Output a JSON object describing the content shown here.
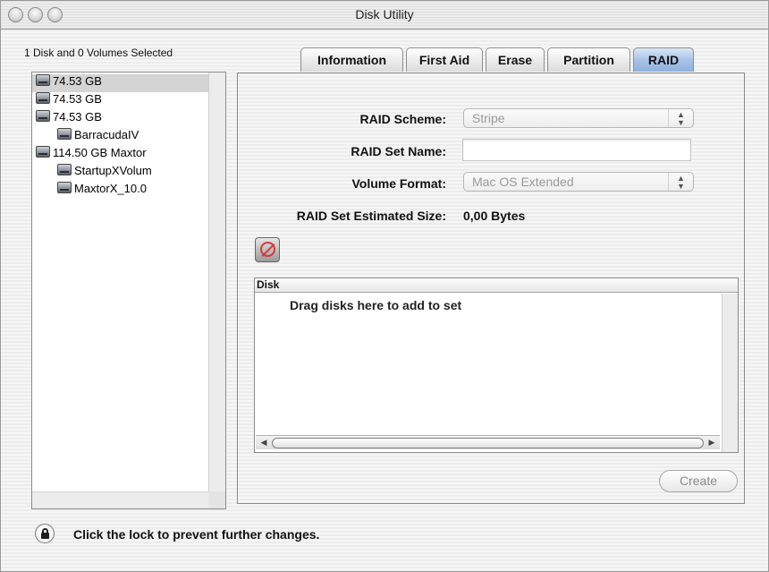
{
  "window": {
    "title": "Disk Utility"
  },
  "sidebar": {
    "selection_summary": "1 Disk and 0 Volumes Selected",
    "items": [
      {
        "label": "74.53 GB",
        "icon": "hard-drive-icon",
        "selected": true
      },
      {
        "label": "74.53 GB",
        "icon": "hard-drive-icon"
      },
      {
        "label": "74.53 GB",
        "icon": "hard-drive-icon"
      },
      {
        "label": "BarracudaIV",
        "icon": "volume-icon"
      },
      {
        "label": "114.50 GB Maxtor",
        "icon": "hard-drive-icon"
      },
      {
        "label": "StartupXVolum",
        "icon": "volume-icon"
      },
      {
        "label": "MaxtorX_10.0",
        "icon": "volume-icon"
      }
    ]
  },
  "tabs": [
    {
      "label": "Information"
    },
    {
      "label": "First Aid"
    },
    {
      "label": "Erase"
    },
    {
      "label": "Partition"
    },
    {
      "label": "RAID",
      "active": true
    }
  ],
  "raid": {
    "scheme_label": "RAID Scheme:",
    "scheme_value": "Stripe",
    "set_name_label": "RAID Set Name:",
    "set_name_value": "",
    "volume_format_label": "Volume Format:",
    "volume_format_value": "Mac OS Extended",
    "estimated_size_label": "RAID Set Estimated Size:",
    "estimated_size_value": "0,00 Bytes"
  },
  "disk_table": {
    "header": "Disk",
    "empty_message": "Drag disks here to add to set"
  },
  "buttons": {
    "create_label": "Create"
  },
  "footer": {
    "lock_message": "Click the lock to prevent further changes."
  },
  "colors": {
    "active_tab": "#a9c3e6",
    "selection": "#d4d4d4",
    "disabled_text": "#9a9a9a",
    "delete_icon": "#d43c3c"
  }
}
